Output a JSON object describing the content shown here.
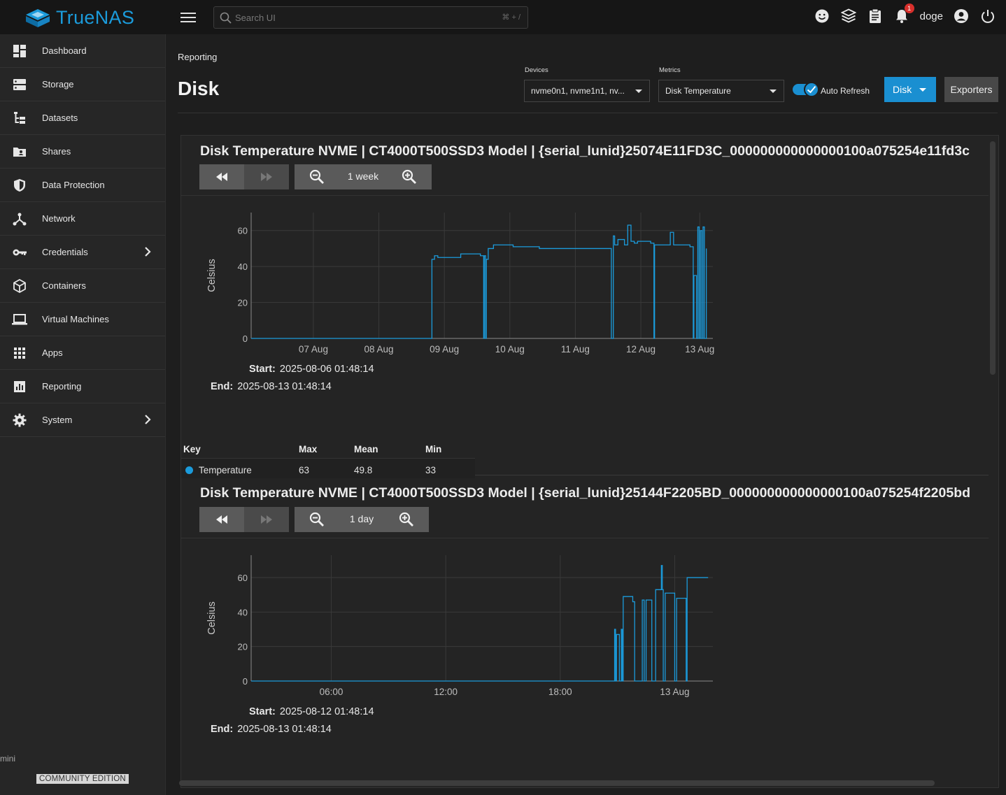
{
  "app": {
    "name": "TrueNAS"
  },
  "search": {
    "placeholder": "Search UI",
    "shortcut": "⌘ + /"
  },
  "topbar": {
    "username": "doge",
    "notifications_count": "1",
    "icons": [
      "feedback-icon",
      "truecommand-icon",
      "jobs-icon",
      "notifications-icon",
      "account-icon",
      "power-icon"
    ]
  },
  "sidebar": {
    "items": [
      {
        "label": "Dashboard",
        "icon": "dashboard-icon"
      },
      {
        "label": "Storage",
        "icon": "storage-icon"
      },
      {
        "label": "Datasets",
        "icon": "datasets-icon"
      },
      {
        "label": "Shares",
        "icon": "shares-icon"
      },
      {
        "label": "Data Protection",
        "icon": "shield-icon"
      },
      {
        "label": "Network",
        "icon": "network-icon"
      },
      {
        "label": "Credentials",
        "icon": "key-icon",
        "expandable": true
      },
      {
        "label": "Containers",
        "icon": "cube-icon"
      },
      {
        "label": "Virtual Machines",
        "icon": "laptop-icon"
      },
      {
        "label": "Apps",
        "icon": "apps-grid-icon"
      },
      {
        "label": "Reporting",
        "icon": "reporting-icon"
      },
      {
        "label": "System",
        "icon": "gear-icon",
        "expandable": true
      }
    ],
    "hostname": "mini",
    "edition": "COMMUNITY EDITION"
  },
  "header": {
    "breadcrumb": "Reporting",
    "title": "Disk",
    "devices_label": "Devices",
    "devices_value": "nvme0n1, nvme1n1, nv...",
    "metrics_label": "Metrics",
    "metrics_value": "Disk Temperature",
    "auto_refresh_label": "Auto Refresh",
    "auto_refresh_on": true,
    "disk_button": "Disk",
    "exporters_button": "Exporters"
  },
  "colors": {
    "accent": "#1a8fd1",
    "series": "#1b9bdb"
  },
  "cards": [
    {
      "title": "Disk Temperature NVME | CT4000T500SSD3 Model | {serial_lunid}25074E11FD3C_000000000000000100a075254e11fd3c",
      "zoom_label": "1 week",
      "start_label": "Start:",
      "start": "2025-08-06 01:48:14",
      "end_label": "End:",
      "end": "2025-08-13 01:48:14",
      "chart_data": {
        "type": "line",
        "ylabel": "Celsius",
        "ylim": [
          0,
          70
        ],
        "yticks": [
          0,
          20,
          40,
          60
        ],
        "xticks": [
          "07 Aug",
          "08 Aug",
          "09 Aug",
          "10 Aug",
          "11 Aug",
          "12 Aug",
          "13 Aug"
        ],
        "series": [
          {
            "name": "Temperature",
            "x_days": [
              0,
              2.75,
              2.76,
              2.8,
              2.85,
              3.2,
              3.2,
              3.5,
              3.55,
              3.56,
              3.58,
              3.59,
              3.62,
              3.7,
              4.0,
              4.4,
              4.8,
              5.2,
              5.5,
              5.5,
              5.53,
              5.55,
              5.6,
              5.7,
              5.75,
              5.8,
              5.85,
              5.9,
              6.1,
              6.15,
              6.16,
              6.4,
              6.45,
              6.47,
              6.7,
              6.75,
              6.76,
              6.8,
              6.82,
              6.84,
              6.86,
              6.88,
              6.9,
              6.92,
              6.95
            ],
            "values": [
              0,
              0,
              44,
              46,
              45,
              46,
              47,
              46,
              0,
              46,
              0,
              44,
              50,
              52,
              51,
              50,
              50,
              50,
              50,
              0,
              57,
              52,
              55,
              52,
              63,
              54,
              53,
              54,
              53,
              0,
              52,
              59,
              52,
              52,
              51,
              0,
              35,
              0,
              62,
              0,
              60,
              0,
              62,
              0,
              50
            ]
          }
        ],
        "legend": {
          "key": "Key",
          "max": "Max",
          "mean": "Mean",
          "min": "Min",
          "row": {
            "name": "Temperature",
            "max": "63",
            "mean": "49.8",
            "min": "33"
          }
        }
      }
    },
    {
      "title": "Disk Temperature NVME | CT4000T500SSD3 Model | {serial_lunid}25144F2205BD_000000000000000100a075254f2205bd",
      "zoom_label": "1 day",
      "start_label": "Start:",
      "start": "2025-08-12 01:48:14",
      "end_label": "End:",
      "end": "2025-08-13 01:48:14",
      "chart_data": {
        "type": "line",
        "ylabel": "Celsius",
        "ylim": [
          0,
          73
        ],
        "yticks": [
          0,
          20,
          40,
          60
        ],
        "xticks": [
          "06:00",
          "12:00",
          "18:00",
          "13 Aug"
        ],
        "series": [
          {
            "name": "Temperature",
            "x_hours": [
              0,
              19,
              19.05,
              19.1,
              19.15,
              19.3,
              19.4,
              19.45,
              19.5,
              20.0,
              20.1,
              20.5,
              20.6,
              20.7,
              21.0,
              21.2,
              21.4,
              21.5,
              21.55,
              21.6,
              21.7,
              22.1,
              22.2,
              22.3,
              22.7,
              22.8,
              22.85,
              23.2,
              23.3,
              23.35,
              23.4,
              23.6,
              23.95
            ],
            "values": [
              0,
              0,
              30,
              0,
              27,
              0,
              30,
              0,
              49,
              46,
              0,
              47,
              0,
              47,
              0,
              53,
              53,
              67,
              53,
              0,
              51,
              51,
              0,
              48,
              48,
              0,
              60,
              60,
              60,
              60,
              60,
              60,
              60
            ]
          }
        ]
      }
    }
  ]
}
